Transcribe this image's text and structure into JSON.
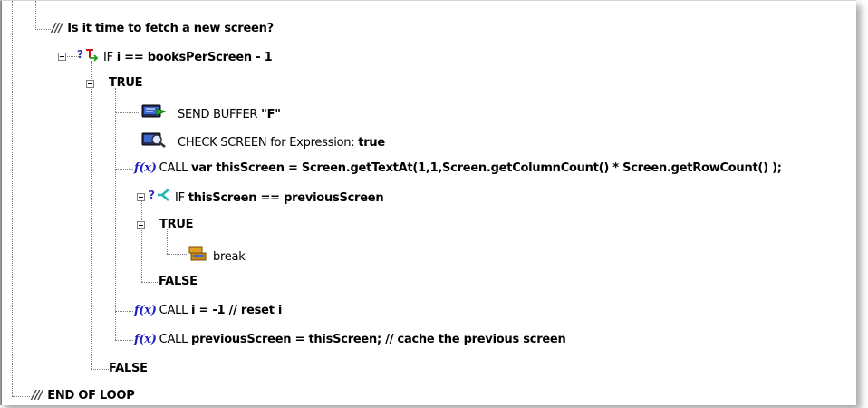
{
  "tree": {
    "row1_comment": "Is it time to fetch a new screen?",
    "row2_if_keyword": "IF",
    "row2_if_expr": "i == booksPerScreen - 1",
    "row3_true": "TRUE",
    "row4_send_keyword": "SEND BUFFER",
    "row4_send_value": "\"F\"",
    "row5_check_keyword": "CHECK SCREEN for Expression:",
    "row5_check_value": "true",
    "row6_call_keyword": "CALL",
    "row6_call_expr": "var thisScreen = Screen.getTextAt(1,1,Screen.getColumnCount() * Screen.getRowCount() );",
    "row7_if_keyword": "IF",
    "row7_if_expr": "thisScreen == previousScreen",
    "row8_true": "TRUE",
    "row9_break": "break",
    "row10_false": "FALSE",
    "row11_call_keyword": "CALL",
    "row11_call_expr": "i = -1  //  reset  i",
    "row12_call_keyword": "CALL",
    "row12_call_expr": "previousScreen = thisScreen;  // cache the previous screen",
    "row13_false": "FALSE",
    "row14_comment": "END OF LOOP",
    "fx_label": "f(x)",
    "comment_glyph": "///",
    "if_question": "?"
  },
  "icons": {
    "comment": "comment-slashes-icon",
    "if_condition": "if-condition-icon",
    "if_branch": "if-branch-icon",
    "send_buffer": "send-buffer-icon",
    "check_screen": "check-screen-icon",
    "function_call": "function-call-icon",
    "break": "break-icon"
  },
  "colors": {
    "fx": "#2020c0",
    "if_arrow_green": "#19a019",
    "if_branch_teal": "#20b8b0",
    "question_mark": "#3030c0"
  }
}
